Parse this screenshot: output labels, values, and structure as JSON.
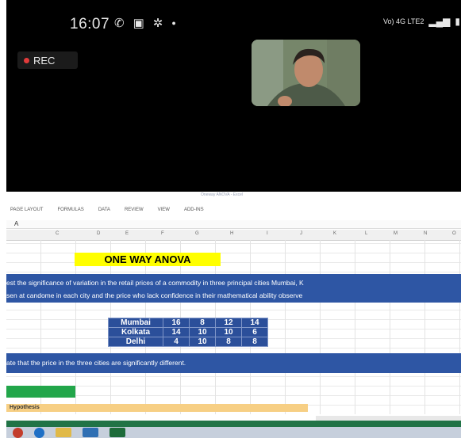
{
  "status_bar": {
    "time": "16:07",
    "network": "Vo) 4G LTE2"
  },
  "recording": {
    "label": "REC"
  },
  "sheet": {
    "ribbon_title": "Oneway ANOVA - Excel",
    "ribbon_tabs": [
      "PAGE LAYOUT",
      "FORMULAS",
      "DATA",
      "REVIEW",
      "VIEW",
      "ADD-INS"
    ],
    "formula_cell": "A",
    "column_letters": [
      "C",
      "D",
      "E",
      "F",
      "G",
      "H",
      "I",
      "J",
      "K",
      "L",
      "M",
      "N",
      "O"
    ],
    "title": "ONE WAY ANOVA",
    "description_line1": "est the significance of variation in the retail prices of a commodity in three principal cities Mumbai, K",
    "description_line2": "sen at candome in each city and the price who lack confidence in their mathematical ability observe",
    "table": [
      {
        "city": "Mumbai",
        "values": [
          "16",
          "8",
          "12",
          "14"
        ]
      },
      {
        "city": "Kolkata",
        "values": [
          "14",
          "10",
          "10",
          "6"
        ]
      },
      {
        "city": "Delhi",
        "values": [
          "4",
          "10",
          "8",
          "8"
        ]
      }
    ],
    "conclusion": "ate that the price in the three cities are significantly different.",
    "hypothesis_label": "Hypothesis"
  },
  "colors": {
    "title_bg": "#ffff00",
    "band_bg": "#2e56a4",
    "table_bg": "#2b4f9a",
    "green_cell": "#22a64a",
    "hypothesis_bg": "#f7cf84"
  }
}
